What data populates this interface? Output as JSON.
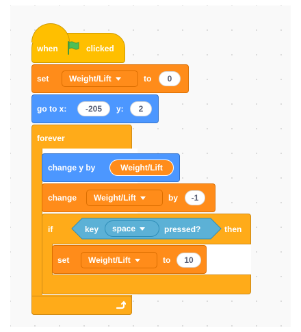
{
  "script": {
    "when_flag": {
      "label_when": "when",
      "label_clicked": "clicked",
      "icon": "green-flag-icon"
    },
    "set_top": {
      "label": "set",
      "variable": "Weight/Lift",
      "label_to": "to",
      "value": "0"
    },
    "goto": {
      "label": "go to x:",
      "x": "-205",
      "label_y": "y:",
      "y": "2"
    },
    "forever": {
      "label": "forever",
      "icon": "loop-arrow-icon"
    },
    "change_y": {
      "label": "change y by",
      "reporter": "Weight/Lift"
    },
    "change_var": {
      "label": "change",
      "variable": "Weight/Lift",
      "label_by": "by",
      "value": "-1"
    },
    "if_block": {
      "label_if": "if",
      "label_then": "then",
      "condition": {
        "label_key": "key",
        "key": "space",
        "label_pressed": "pressed?"
      }
    },
    "set_inner": {
      "label": "set",
      "variable": "Weight/Lift",
      "label_to": "to",
      "value": "10"
    }
  },
  "colors": {
    "events": "#FFBF00",
    "variables": "#FF8C1A",
    "motion": "#4C97FF",
    "control": "#FFAB19",
    "sensing": "#5CB1D6",
    "flag": "#4CBF56"
  }
}
